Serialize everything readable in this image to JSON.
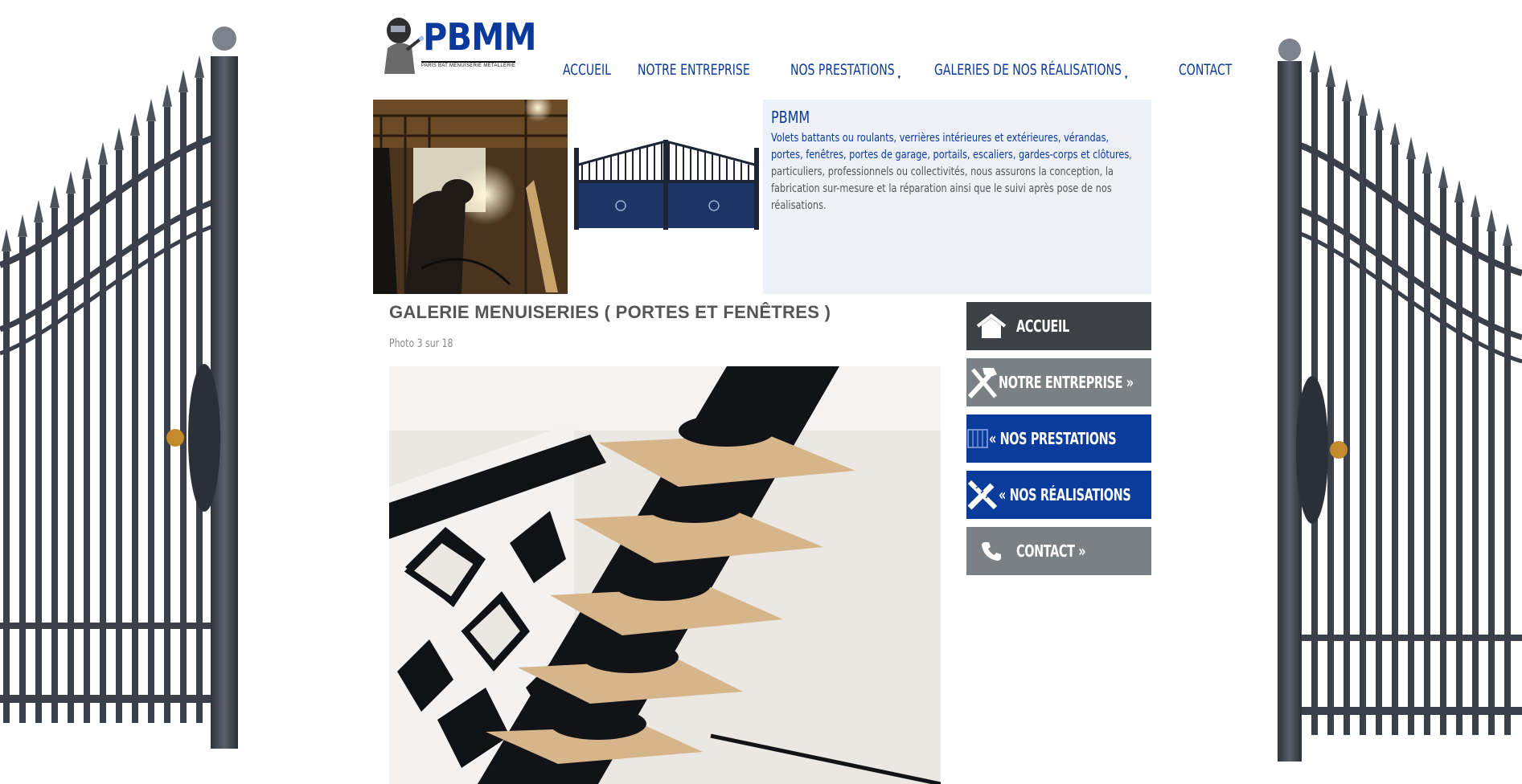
{
  "brand": {
    "logo_text": "PBMM",
    "logo_subtitle": "PARIS BAT MENUISERIE METALLERIE"
  },
  "nav": {
    "items": [
      {
        "label": "ACCUEIL",
        "has_submenu": false
      },
      {
        "label": "NOTRE ENTREPRISE",
        "has_submenu": false
      },
      {
        "label": "NOS PRESTATIONS",
        "has_submenu": true
      },
      {
        "label": "GALERIES DE NOS RÉALISATIONS",
        "has_submenu": true
      },
      {
        "label": "CONTACT",
        "has_submenu": false
      }
    ],
    "caret": "▾"
  },
  "intro": {
    "title": "PBMM",
    "highlight": "Volets battants ou roulants, verrières intérieures et extérieures, vérandas, portes, fenêtres, portes de garage, portails, escaliers, gardes-corps et clôtures",
    "text": ", particuliers, professionnels ou collectivités, nous assurons la conception, la fabrication sur-mesure et la réparation ainsi que le suivi après pose de nos réalisations."
  },
  "gallery": {
    "title": "GALERIE MENUISERIES ( PORTES ET FENÊTRES )",
    "counter": "Photo 3 sur 18"
  },
  "sidebar": {
    "items": [
      {
        "label": "ACCUEIL",
        "icon": "home-icon",
        "bg": "#3d4147"
      },
      {
        "label": "NOTRE ENTREPRISE »",
        "icon": "tools-icon",
        "bg": "#7a8184"
      },
      {
        "label": "« NOS PRESTATIONS",
        "icon": "building-icon",
        "bg": "#0a3c9e"
      },
      {
        "label": "« NOS RÉALISATIONS",
        "icon": "ruler-pencil-icon",
        "bg": "#0a3c9e"
      },
      {
        "label": "CONTACT »",
        "icon": "phone-icon",
        "bg": "#7a8184"
      }
    ]
  },
  "colors": {
    "brand_blue": "#0b3a9c",
    "intro_bg": "#edf1f7",
    "gate_metal": "#3a404a"
  }
}
